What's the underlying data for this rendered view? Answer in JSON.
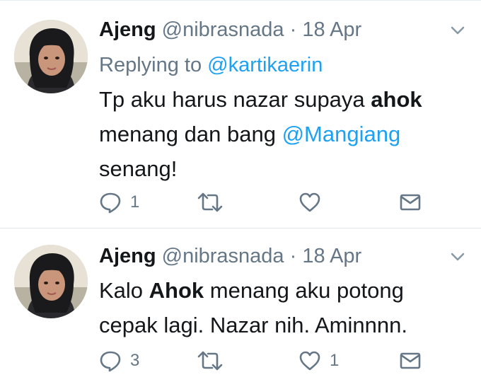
{
  "tweets": [
    {
      "name": "Ajeng",
      "handle": "@nibrasnada",
      "separator": "·",
      "date": "18 Apr",
      "replying_prefix": "Replying to",
      "replying_to": "@kartikaerin",
      "text_line1_plain": "Tp aku harus nazar supaya ",
      "text_line1_bold": "ahok",
      "text_line2_plain": "menang dan bang ",
      "text_line2_mention": "@Mangiang",
      "text_line3": "senang!",
      "reply_count": "1",
      "retweet_count": "",
      "like_count": ""
    },
    {
      "name": "Ajeng",
      "handle": "@nibrasnada",
      "separator": "·",
      "date": "18 Apr",
      "text_line1_before": "Kalo ",
      "text_line1_bold": "Ahok",
      "text_line1_after": " menang aku potong",
      "text_line2": "cepak lagi. Nazar nih. Aminnnn.",
      "reply_count": "3",
      "retweet_count": "",
      "like_count": "1"
    }
  ],
  "icons": {
    "reply": "reply-bubble-icon",
    "retweet": "retweet-icon",
    "like": "heart-icon",
    "dm": "envelope-icon",
    "more": "chevron-down-icon"
  },
  "colors": {
    "text": "#14171a",
    "secondary": "#657786",
    "link": "#1da1f2",
    "divider": "#e1e8ed"
  }
}
